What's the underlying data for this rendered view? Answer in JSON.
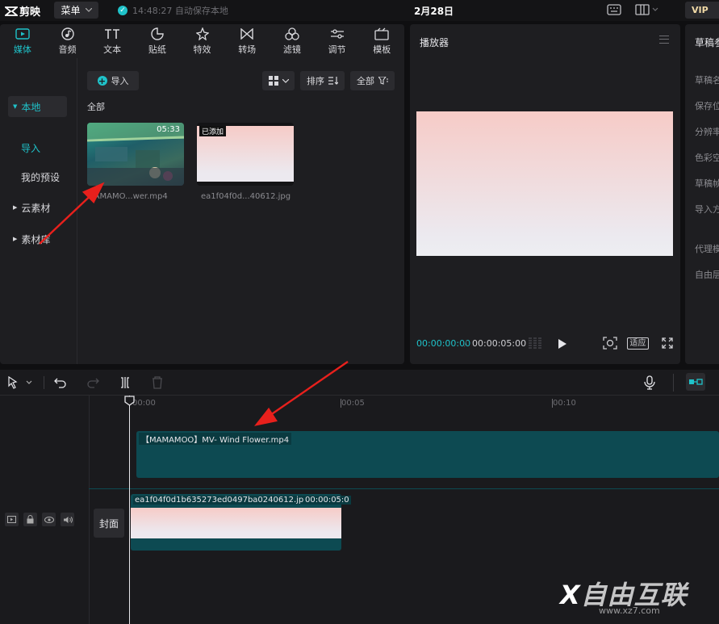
{
  "app": {
    "name": "剪映",
    "menu_label": "菜单",
    "save_status": "14:48:27 自动保存本地",
    "date": "2月28日",
    "vip": "VIP"
  },
  "tabs": [
    {
      "label": "媒体",
      "icon": "media-icon"
    },
    {
      "label": "音频",
      "icon": "audio-icon"
    },
    {
      "label": "文本",
      "icon": "text-icon"
    },
    {
      "label": "贴纸",
      "icon": "sticker-icon"
    },
    {
      "label": "特效",
      "icon": "effects-icon"
    },
    {
      "label": "转场",
      "icon": "transition-icon"
    },
    {
      "label": "滤镜",
      "icon": "filter-icon"
    },
    {
      "label": "调节",
      "icon": "adjust-icon"
    },
    {
      "label": "模板",
      "icon": "template-icon"
    }
  ],
  "sidebar": {
    "local": "本地",
    "import": "导入",
    "my_presets": "我的预设",
    "cloud": "云素材",
    "library": "素材库"
  },
  "media": {
    "import_label": "导入",
    "sort_label": "排序",
    "filter_label": "全部",
    "section_all": "全部",
    "items": [
      {
        "name": "MAMAMO...wer.mp4",
        "duration": "05:33"
      },
      {
        "name": "ea1f04f0d...40612.jpg",
        "badge": "已添加"
      }
    ]
  },
  "player": {
    "title": "播放器",
    "current_time": "00:00:00:00",
    "total_time": "00:00:05:00",
    "fit_label": "适应"
  },
  "draft": {
    "title": "草稿参",
    "fields": [
      "草稿名",
      "保存位",
      "分辨率",
      "色彩空",
      "草稿帧",
      "导入方",
      "代理模",
      "自由层"
    ]
  },
  "timeline": {
    "ruler": [
      "00:00",
      "00:05",
      "00:10"
    ],
    "clips": [
      {
        "label": "【MAMAMOO】MV- Wind Flower.mp4"
      },
      {
        "label": "ea1f04f0d1b635273ed0497ba0240612.jpg",
        "duration": "00:00:05:0"
      }
    ],
    "cover_label": "封面"
  },
  "watermark": {
    "text": "自由互联",
    "sub": "www.xz7.com"
  },
  "colors": {
    "accent": "#1fc2c9",
    "clip": "#0d4a52",
    "panel": "#1e1e21"
  }
}
